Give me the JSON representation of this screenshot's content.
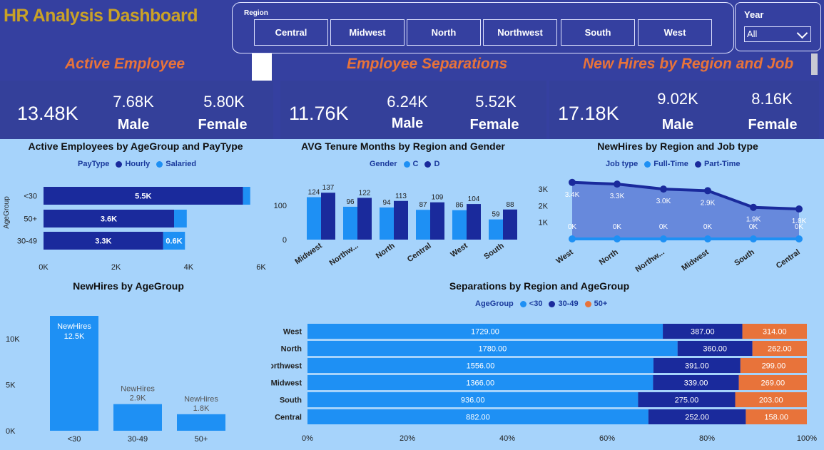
{
  "header": {
    "title": "HR Analysis Dashboard",
    "region_label": "Region",
    "regions": [
      "Central",
      "Midwest",
      "North",
      "Northwest",
      "South",
      "West"
    ],
    "year_label": "Year",
    "year_value": "All"
  },
  "sections": {
    "active": "Active Employee",
    "separations": "Employee Separations",
    "new_hires": "New Hires by Region and Job"
  },
  "kpis": {
    "active": {
      "total": "13.48K",
      "male_value": "7.68K",
      "male_label": "Male",
      "female_value": "5.80K",
      "female_label": "Female"
    },
    "separations": {
      "total": "11.76K",
      "male_value": "6.24K",
      "male_label": "Male",
      "female_value": "5.52K",
      "female_label": "Female"
    },
    "new_hires": {
      "total": "17.18K",
      "male_value": "9.02K",
      "male_label": "Male",
      "female_value": "8.16K",
      "female_label": "Female"
    }
  },
  "colors": {
    "header": "#3540a0",
    "background": "#a6d3fb",
    "accent_orange": "#e8733a",
    "title_gold": "#c9a227",
    "light_blue": "#1e90f4",
    "dark_blue": "#1a2a9c",
    "orange": "#e8733a"
  },
  "chart_data": [
    {
      "id": "active_age_pay",
      "type": "bar",
      "orientation": "horizontal",
      "stacked": true,
      "title": "Active Employees by AgeGroup and PayType",
      "legend_title": "PayType",
      "ylabel": "AgeGroup",
      "categories": [
        "<30",
        "50+",
        "30-49"
      ],
      "series": [
        {
          "name": "Hourly",
          "values": [
            5500,
            3600,
            3300
          ],
          "labels": [
            "5.5K",
            "3.6K",
            "3.3K"
          ],
          "color": "#1a2a9c"
        },
        {
          "name": "Salaried",
          "values": [
            200,
            350,
            600
          ],
          "labels": [
            "",
            "",
            "0.6K"
          ],
          "color": "#1e90f4"
        }
      ],
      "xlim": [
        0,
        6000
      ],
      "xticks": [
        "0K",
        "2K",
        "4K",
        "6K"
      ]
    },
    {
      "id": "tenure_region_gender",
      "type": "bar",
      "title": "AVG Tenure Months by Region and Gender",
      "legend_title": "Gender",
      "categories": [
        "Midwest",
        "Northw...",
        "North",
        "Central",
        "West",
        "South"
      ],
      "series": [
        {
          "name": "C",
          "values": [
            124,
            96,
            94,
            87,
            86,
            59
          ],
          "color": "#1e90f4"
        },
        {
          "name": "D",
          "values": [
            137,
            122,
            113,
            109,
            104,
            88
          ],
          "color": "#1a2a9c"
        }
      ],
      "yticks": [
        "0",
        "100"
      ],
      "ylim": [
        0,
        150
      ]
    },
    {
      "id": "newhires_region_job",
      "type": "line",
      "title": "NewHires by Region and Job type",
      "legend_title": "Job type",
      "categories": [
        "West",
        "North",
        "Northw...",
        "Midwest",
        "South",
        "Central"
      ],
      "series": [
        {
          "name": "Full-Time",
          "values": [
            0,
            0,
            0,
            0,
            0,
            0
          ],
          "labels": [
            "0K",
            "0K",
            "0K",
            "0K",
            "0K",
            "0K"
          ],
          "color": "#1e90f4"
        },
        {
          "name": "Part-Time",
          "values": [
            3400,
            3300,
            3000,
            2900,
            1900,
            1800
          ],
          "labels": [
            "3.4K",
            "3.3K",
            "3.0K",
            "2.9K",
            "1.9K",
            "1.8K"
          ],
          "color": "#1a2a9c"
        }
      ],
      "yticks": [
        "1K",
        "2K",
        "3K"
      ],
      "ylim": [
        0,
        3500
      ]
    },
    {
      "id": "newhires_age",
      "type": "bar",
      "title": "NewHires by AgeGroup",
      "categories": [
        "<30",
        "30-49",
        "50+"
      ],
      "values": [
        12500,
        2900,
        1800
      ],
      "labels": [
        "12.5K",
        "2.9K",
        "1.8K"
      ],
      "series_label": "NewHires",
      "yticks": [
        "0K",
        "5K",
        "10K"
      ],
      "ylim": [
        0,
        12500
      ],
      "color": "#1e90f4"
    },
    {
      "id": "separations_region_age",
      "type": "bar",
      "orientation": "horizontal",
      "stacked": true,
      "percent": true,
      "title": "Separations by Region and AgeGroup",
      "legend_title": "AgeGroup",
      "categories": [
        "West",
        "North",
        "Northwest",
        "Midwest",
        "South",
        "Central"
      ],
      "series": [
        {
          "name": "<30",
          "values": [
            1729,
            1780,
            1556,
            1366,
            936,
            882
          ],
          "color": "#1e90f4"
        },
        {
          "name": "30-49",
          "values": [
            387,
            360,
            391,
            339,
            275,
            252
          ],
          "color": "#1a2a9c"
        },
        {
          "name": "50+",
          "values": [
            314,
            262,
            299,
            269,
            203,
            158
          ],
          "color": "#e8733a"
        }
      ],
      "xticks": [
        "0%",
        "20%",
        "40%",
        "60%",
        "80%",
        "100%"
      ]
    }
  ]
}
